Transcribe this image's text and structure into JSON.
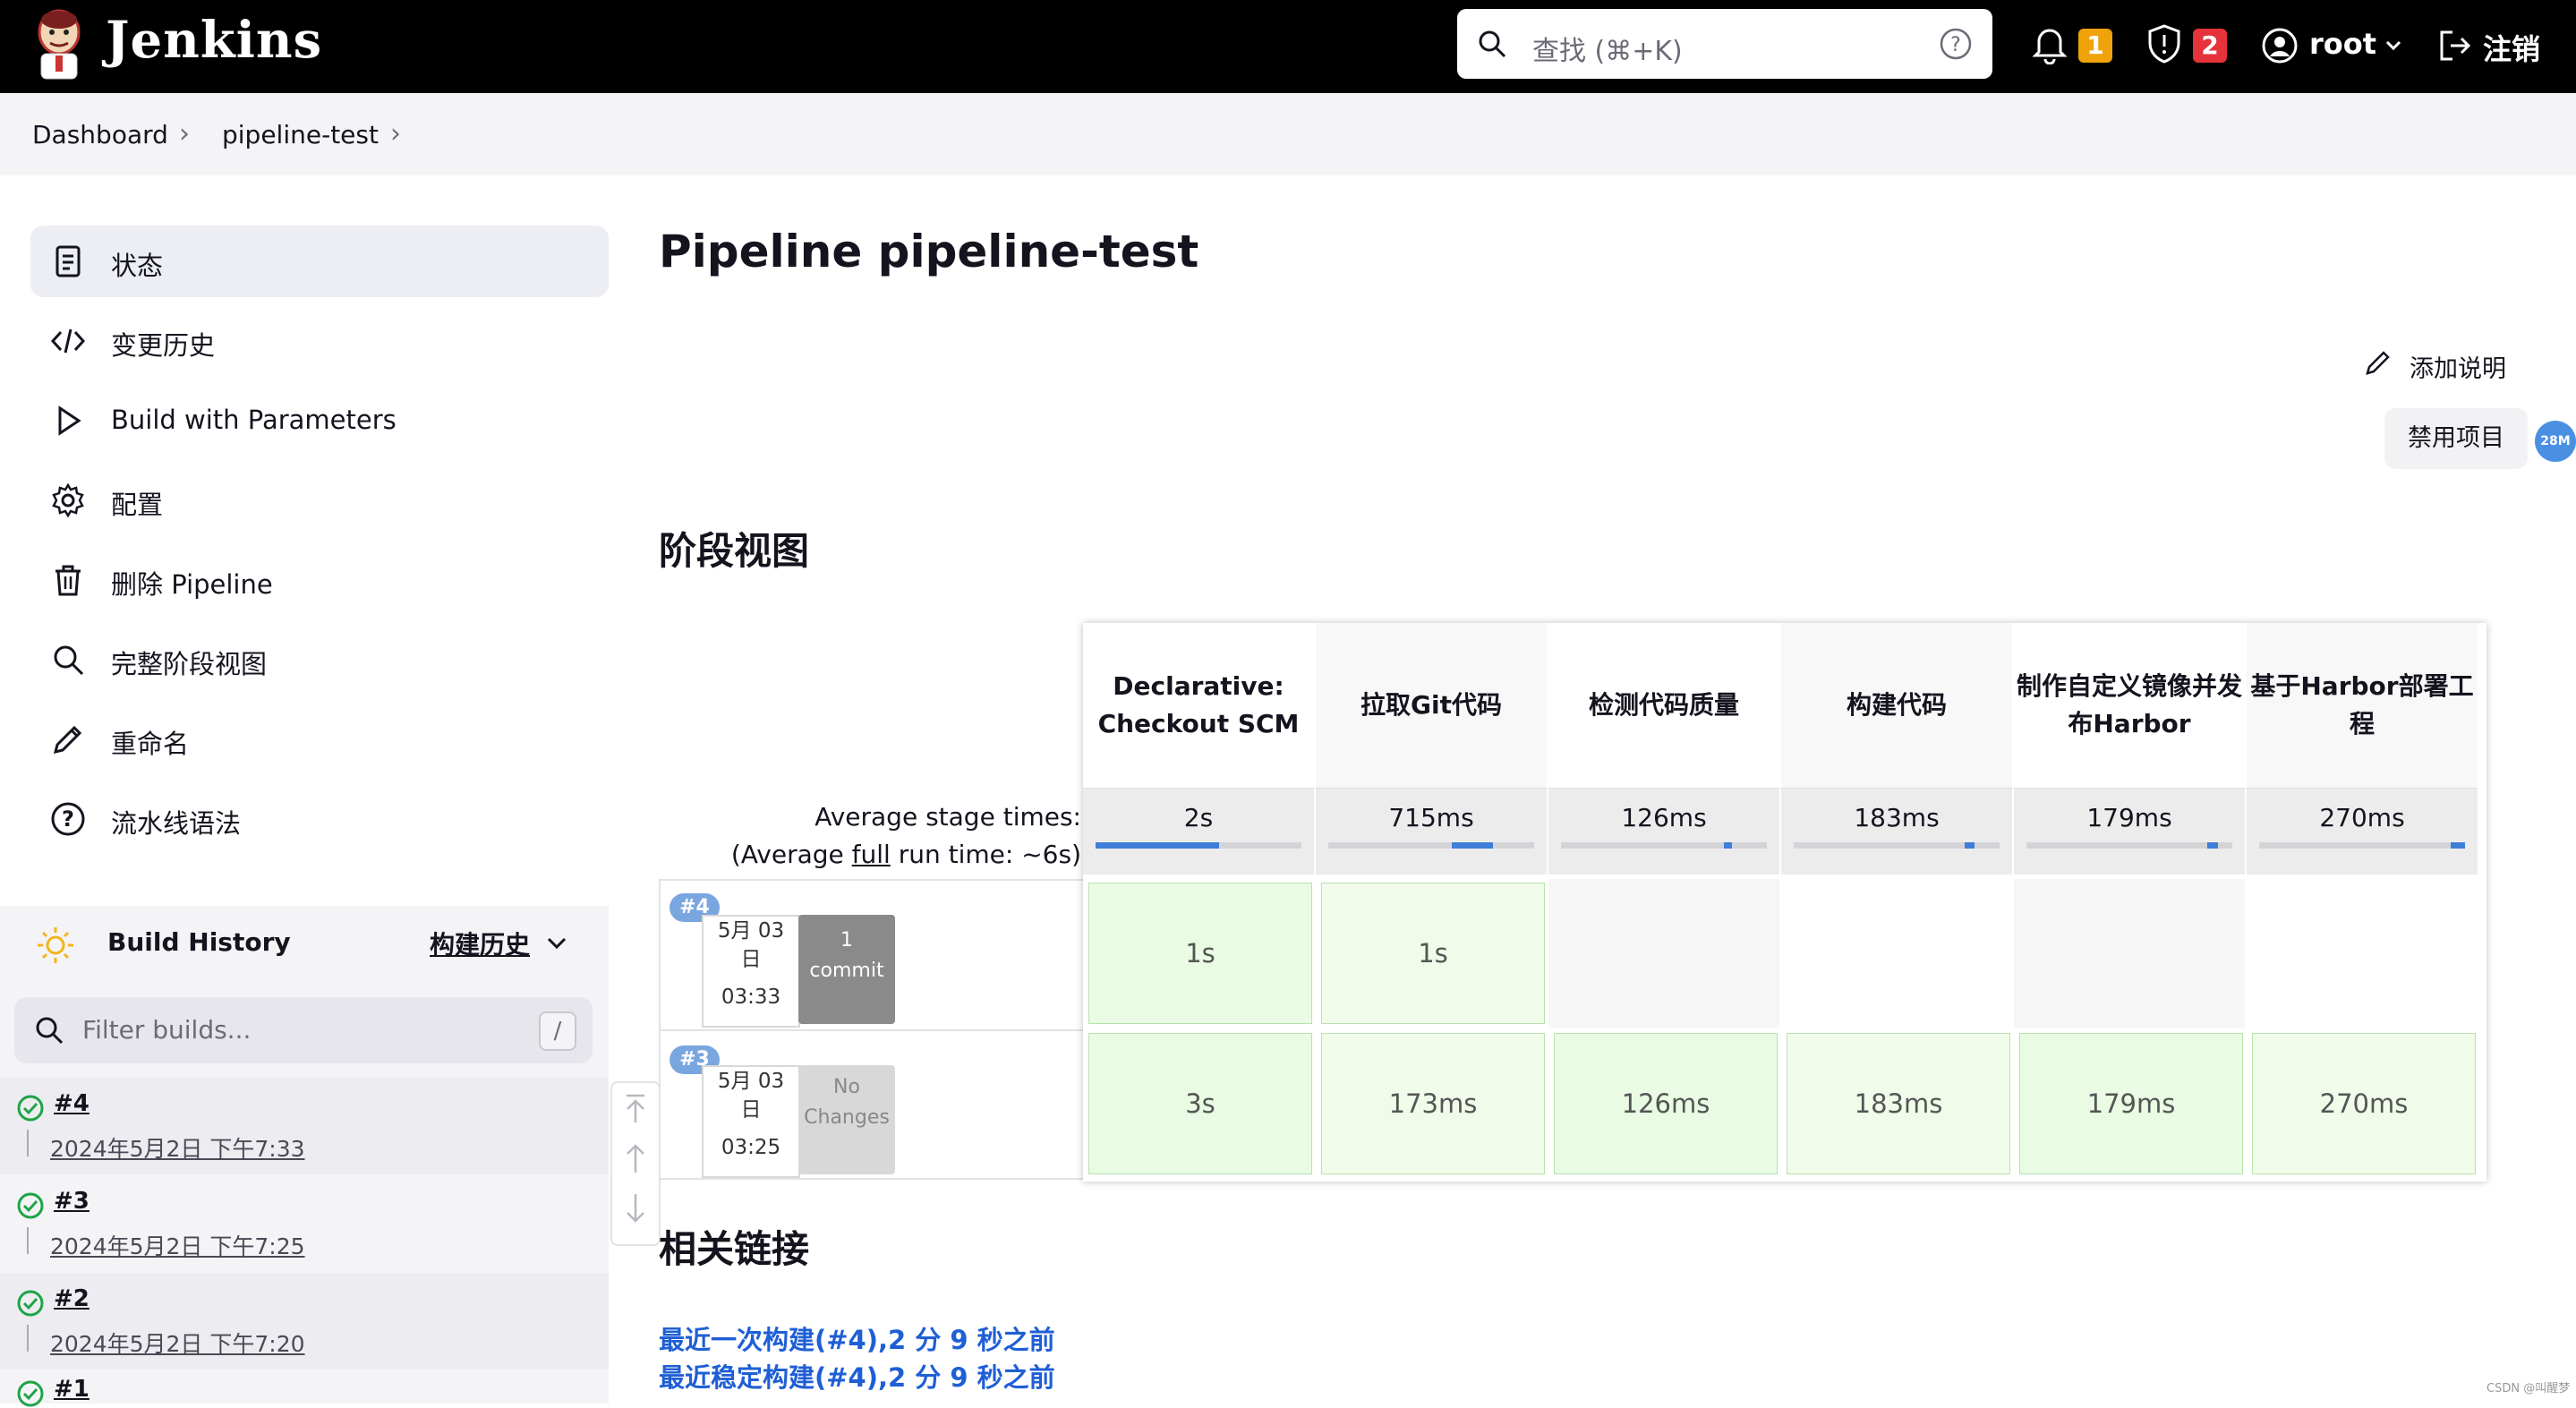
{
  "header": {
    "brand": "Jenkins",
    "search_placeholder": "查找 (⌘+K)",
    "notifications_count": "1",
    "security_count": "2",
    "user": "root",
    "logout": "注销",
    "colors": {
      "bg": "#000000",
      "notif_badge": "#f0a20a",
      "security_badge": "#e6333b"
    }
  },
  "breadcrumb": [
    "Dashboard",
    "pipeline-test"
  ],
  "sidebar": {
    "tasks": [
      {
        "label": "状态",
        "icon": "document-icon"
      },
      {
        "label": "变更历史",
        "icon": "code-icon"
      },
      {
        "label": "Build with Parameters",
        "icon": "play-icon"
      },
      {
        "label": "配置",
        "icon": "gear-icon"
      },
      {
        "label": "删除 Pipeline",
        "icon": "trash-icon"
      },
      {
        "label": "完整阶段视图",
        "icon": "search-icon"
      },
      {
        "label": "重命名",
        "icon": "pencil-icon"
      },
      {
        "label": "流水线语法",
        "icon": "help-icon"
      }
    ],
    "build_history": {
      "title": "Build History",
      "link": "构建历史",
      "filter_placeholder": "Filter builds...",
      "filter_key": "/",
      "builds": [
        {
          "num": "#4",
          "date": "2024年5月2日 下午7:33"
        },
        {
          "num": "#3",
          "date": "2024年5月2日 下午7:25"
        },
        {
          "num": "#2",
          "date": "2024年5月2日 下午7:20"
        },
        {
          "num": "#1",
          "date": ""
        }
      ]
    }
  },
  "main": {
    "title": "Pipeline pipeline-test",
    "add_description": "添加说明",
    "disable_project": "禁用项目",
    "memory_badge": "28M",
    "stage_view_heading": "阶段视图",
    "related_heading": "相关链接",
    "avg_stage_label": "Average stage times:",
    "avg_run_prefix": "(Average ",
    "avg_run_link": "full",
    "avg_run_suffix": " run time: ~6s)",
    "stages": [
      {
        "name": "Declarative: Checkout SCM",
        "avg": "2s",
        "bar_start": 0.0,
        "bar_width": 0.6
      },
      {
        "name": "拉取Git代码",
        "avg": "715ms",
        "bar_start": 0.6,
        "bar_width": 0.2
      },
      {
        "name": "检测代码质量",
        "avg": "126ms",
        "bar_start": 0.79,
        "bar_width": 0.04
      },
      {
        "name": "构建代码",
        "avg": "183ms",
        "bar_start": 0.83,
        "bar_width": 0.05
      },
      {
        "name": "制作自定义镜像并发布Harbor",
        "avg": "179ms",
        "bar_start": 0.88,
        "bar_width": 0.05
      },
      {
        "name": "基于Harbor部署工程",
        "avg": "270ms",
        "bar_start": 0.93,
        "bar_width": 0.07
      }
    ],
    "runs": [
      {
        "tag": "#4",
        "date": "5月 03",
        "day": "日",
        "time": "03:33",
        "commit_l1": "1",
        "commit_l2": "commit",
        "has_changes": true,
        "cells": [
          "1s",
          "1s",
          "",
          "",
          "",
          ""
        ]
      },
      {
        "tag": "#3",
        "date": "5月 03",
        "day": "日",
        "time": "03:25",
        "commit_l1": "No",
        "commit_l2": "Changes",
        "has_changes": false,
        "cells": [
          "3s",
          "173ms",
          "126ms",
          "183ms",
          "179ms",
          "270ms"
        ]
      }
    ],
    "related_links": [
      "最近一次构建(#4),2 分 9 秒之前",
      "最近稳定构建(#4),2 分 9 秒之前"
    ]
  },
  "watermark": "CSDN @叫醒梦"
}
